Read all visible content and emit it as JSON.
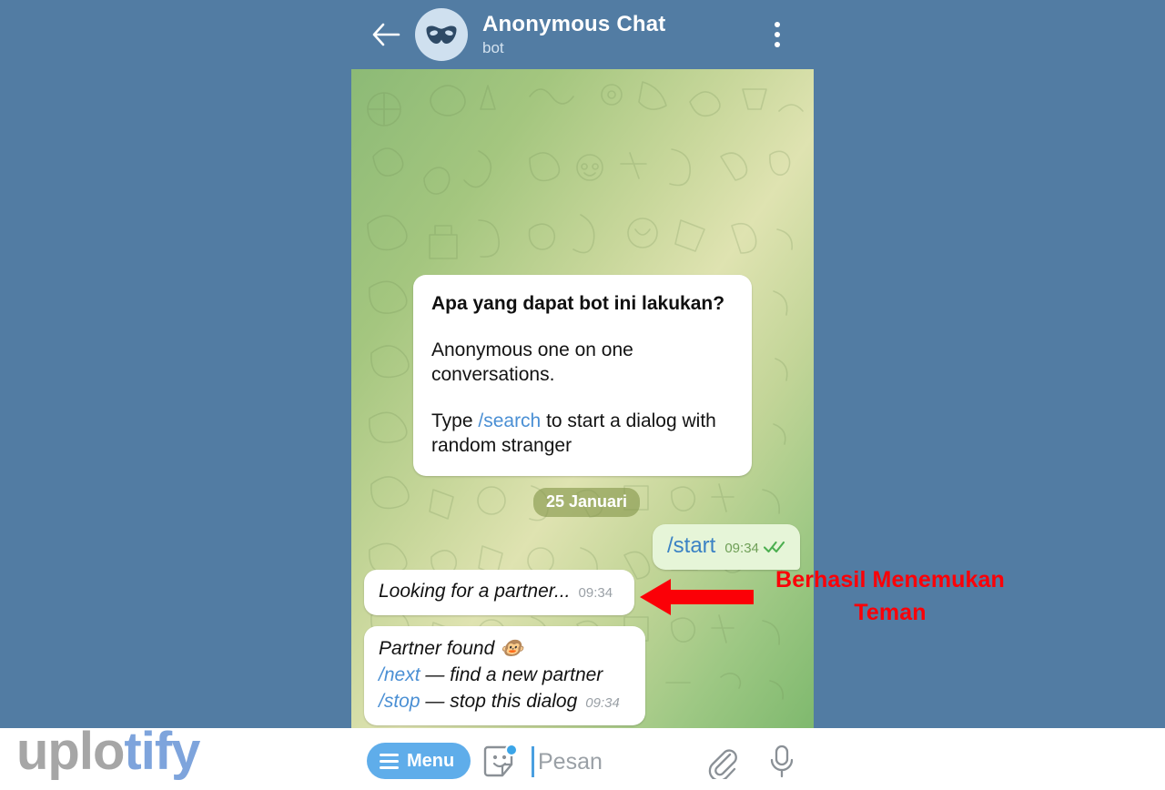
{
  "header": {
    "back_icon": "back-arrow-icon",
    "avatar_icon": "mask-icon",
    "title": "Anonymous Chat",
    "subtitle": "bot",
    "menu_icon": "more-vertical-icon"
  },
  "chat": {
    "intro_bubble": {
      "title": "Apa yang dapat bot ini lakukan?",
      "line1": "Anonymous one on one conversations.",
      "line2_prefix": "Type ",
      "line2_command": "/search",
      "line2_suffix": " to start a dialog with random stranger"
    },
    "date_badge": "25 Januari",
    "outgoing": {
      "text": "/start",
      "time": "09:34",
      "status_icon": "double-check-icon"
    },
    "incoming_searching": {
      "text": "Looking for a partner...",
      "time": "09:34"
    },
    "incoming_found": {
      "line1": "Partner found 🐵",
      "line2_command": "/next",
      "line2_rest": " — find a new partner",
      "line3_command": "/stop",
      "line3_rest": " — stop this dialog",
      "time": "09:34"
    }
  },
  "annotation": {
    "arrow_icon": "left-arrow-annotation",
    "text": "Berhasil Menemukan Teman",
    "color": "#fb0007"
  },
  "input_bar": {
    "menu_label": "Menu",
    "menu_icon": "hamburger-icon",
    "sticker_icon": "sticker-smiley-icon",
    "placeholder": "Pesan",
    "attach_icon": "paperclip-icon",
    "mic_icon": "microphone-icon",
    "accent_color": "#5fadea"
  },
  "watermark": {
    "part1": "uplo",
    "part2": "tify"
  }
}
